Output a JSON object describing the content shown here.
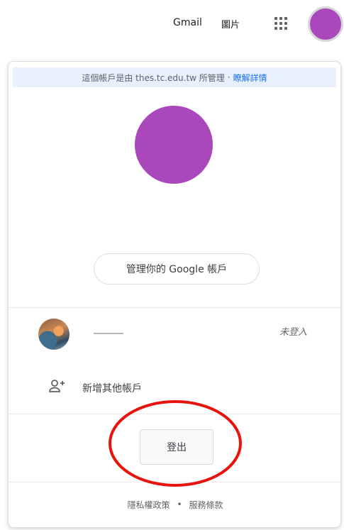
{
  "topbar": {
    "gmail_label": "Gmail",
    "images_label": "圖片",
    "apps_icon": "grid-apps-icon",
    "avatar_color": "#ab47bc"
  },
  "card": {
    "managed_text": "這個帳戶是由 thes.tc.edu.tw 所管理",
    "separator": "·",
    "learn_more": "瞭解詳情",
    "avatar_color": "#ab47bc",
    "manage_account_label": "管理你的 Google 帳戶",
    "account": {
      "status": "未登入"
    },
    "add_account_label": "新增其他帳戶",
    "sign_out_label": "登出",
    "footer": {
      "privacy": "隱私權政策",
      "dot": "•",
      "terms": "服務條款"
    }
  },
  "colors": {
    "accent_link": "#1a73e8",
    "banner_bg": "#e8f0fe",
    "highlight_ring": "#e8130c"
  }
}
